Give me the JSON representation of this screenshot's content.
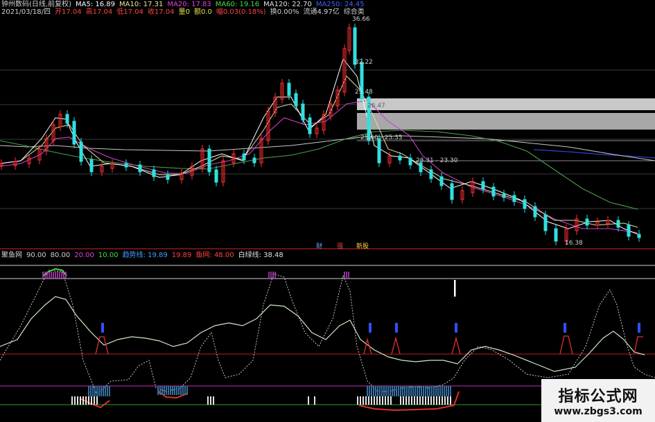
{
  "header": {
    "row1": [
      {
        "text": "钟州数码(日线,前复权)",
        "color": "#d0d0d0"
      },
      {
        "text": "MA5: 16.89",
        "color": "#ffffff"
      },
      {
        "text": "MA10: 17.31",
        "color": "#e8e8a0"
      },
      {
        "text": "MA20: 17.83",
        "color": "#e040e0"
      },
      {
        "text": "MA60: 19.16",
        "color": "#40e040"
      },
      {
        "text": "MA120: 22.70",
        "color": "#e0e0e0"
      },
      {
        "text": "MA250: 24.45",
        "color": "#4060ff"
      }
    ],
    "row2": [
      {
        "text": "2021/03/18/四",
        "color": "#d0d0d0"
      },
      {
        "text": "开17.04",
        "color": "#ff4040"
      },
      {
        "text": "高17.04",
        "color": "#ff4040"
      },
      {
        "text": "低17.04",
        "color": "#ff4040"
      },
      {
        "text": "收17.04",
        "color": "#ff4040"
      },
      {
        "text": "量0",
        "color": "#e0e040"
      },
      {
        "text": "额0.0",
        "color": "#e0e040"
      },
      {
        "text": "幅0.03(0.18%)",
        "color": "#ff4040"
      },
      {
        "text": "换0.00%",
        "color": "#d0d0d0"
      },
      {
        "text": "流通4.97亿",
        "color": "#d0d0d0"
      },
      {
        "text": "综合类",
        "color": "#d0d0d0"
      }
    ]
  },
  "price_chart": {
    "price_labels": {
      "high": "36.66",
      "p1": "32.22",
      "p2": "29.48",
      "low": "16.38"
    },
    "zones": [
      {
        "text": "26.47",
        "color": "#606060"
      },
      {
        "text": "25.60 - 25.35",
        "color": "#d0d0d0"
      },
      {
        "text": "23.31 - 23.30",
        "color": "#d0d0d0"
      }
    ],
    "signals": [
      {
        "text": "财",
        "color": "#6aa0ff"
      },
      {
        "text": "强",
        "color": "#ff4040"
      },
      {
        "text": "新股",
        "color": "#ffd040"
      }
    ]
  },
  "indicator": {
    "name": "聚鱼网",
    "legend": [
      {
        "text": "90.00",
        "color": "#d0d0d0"
      },
      {
        "text": "80.00",
        "color": "#d0d0d0"
      },
      {
        "text": "20.00",
        "color": "#e040e0"
      },
      {
        "text": "10.00",
        "color": "#40e040"
      },
      {
        "text": "趋势线: 19.89",
        "color": "#40a0ff"
      },
      {
        "text": "19.89",
        "color": "#ff4040"
      },
      {
        "text": "鱼网: 48.00",
        "color": "#ff4040"
      },
      {
        "text": "白绿线: 38.48",
        "color": "#e0e0e0"
      }
    ]
  },
  "watermark": {
    "title": "指标公式网",
    "url": "www.zbgs3.com"
  },
  "colors": {
    "up": "#ff3030",
    "down": "#30e0e0",
    "bg": "#000000"
  }
}
